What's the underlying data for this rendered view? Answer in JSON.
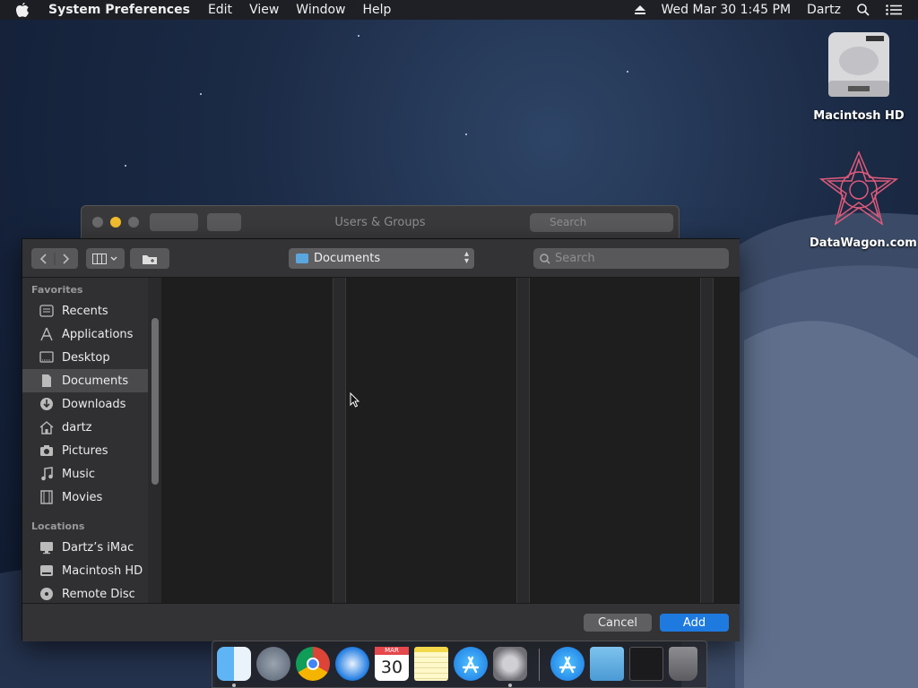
{
  "menubar": {
    "app_name": "System Preferences",
    "menus": [
      "Edit",
      "View",
      "Window",
      "Help"
    ],
    "datetime": "Wed Mar 30  1:45 PM",
    "user": "Dartz"
  },
  "desktop": {
    "icons": [
      {
        "label": "Macintosh HD",
        "icon": "hard-drive-icon"
      },
      {
        "label": "DataWagon.com",
        "icon": "datawagon-logo-icon"
      }
    ]
  },
  "back_window": {
    "title": "Users & Groups",
    "search_placeholder": "Search"
  },
  "open_panel": {
    "location": "Documents",
    "search_placeholder": "Search",
    "sidebar": {
      "favorites_header": "Favorites",
      "favorites": [
        {
          "label": "Recents",
          "icon": "clock-icon"
        },
        {
          "label": "Applications",
          "icon": "applications-icon"
        },
        {
          "label": "Desktop",
          "icon": "desktop-icon"
        },
        {
          "label": "Documents",
          "icon": "document-icon",
          "selected": true
        },
        {
          "label": "Downloads",
          "icon": "download-icon"
        },
        {
          "label": "dartz",
          "icon": "home-icon"
        },
        {
          "label": "Pictures",
          "icon": "camera-icon"
        },
        {
          "label": "Music",
          "icon": "music-note-icon"
        },
        {
          "label": "Movies",
          "icon": "film-icon"
        }
      ],
      "locations_header": "Locations",
      "locations": [
        {
          "label": "Dartz’s iMac",
          "icon": "imac-icon"
        },
        {
          "label": "Macintosh HD",
          "icon": "disk-icon"
        },
        {
          "label": "Remote Disc",
          "icon": "remote-disc-icon"
        }
      ]
    },
    "buttons": {
      "cancel": "Cancel",
      "add": "Add"
    },
    "accent_color": "#1f7ae0"
  },
  "dock": {
    "apps": [
      "Finder",
      "Launchpad",
      "Chrome",
      "Safari",
      "Calendar",
      "Notes",
      "App Store",
      "System Preferences",
      "App Store Downloads",
      "Folder",
      "Screenshot",
      "Trash"
    ],
    "calendar_month": "MAR",
    "calendar_day": "30"
  }
}
